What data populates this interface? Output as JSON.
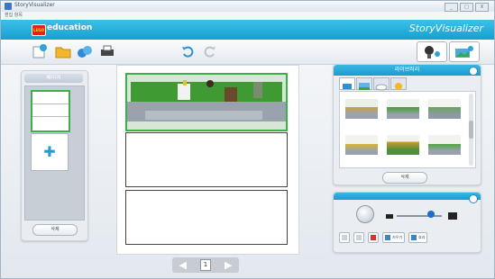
{
  "window": {
    "title": "StoryVisualizer",
    "menu": "편집 항목",
    "controls": [
      "_",
      "□",
      "X"
    ]
  },
  "brand": {
    "lego_text": "LEGO",
    "education": "education",
    "product": "StoryVisualizer"
  },
  "pages_panel": {
    "title": "페이지",
    "delete_label": "삭제"
  },
  "pager": {
    "current_page": "1"
  },
  "library": {
    "title": "라이브러리",
    "tab_icons": [
      "text-icon",
      "landscape-icon",
      "cloud-icon",
      "sun-icon"
    ],
    "delete_label": "삭제"
  },
  "sound_panel": {
    "btn_delete_label": "지우기",
    "btn_effect_label": "효과"
  },
  "colors": {
    "brand_blue": "#1aa3d4",
    "selected_green": "#38b14a"
  }
}
